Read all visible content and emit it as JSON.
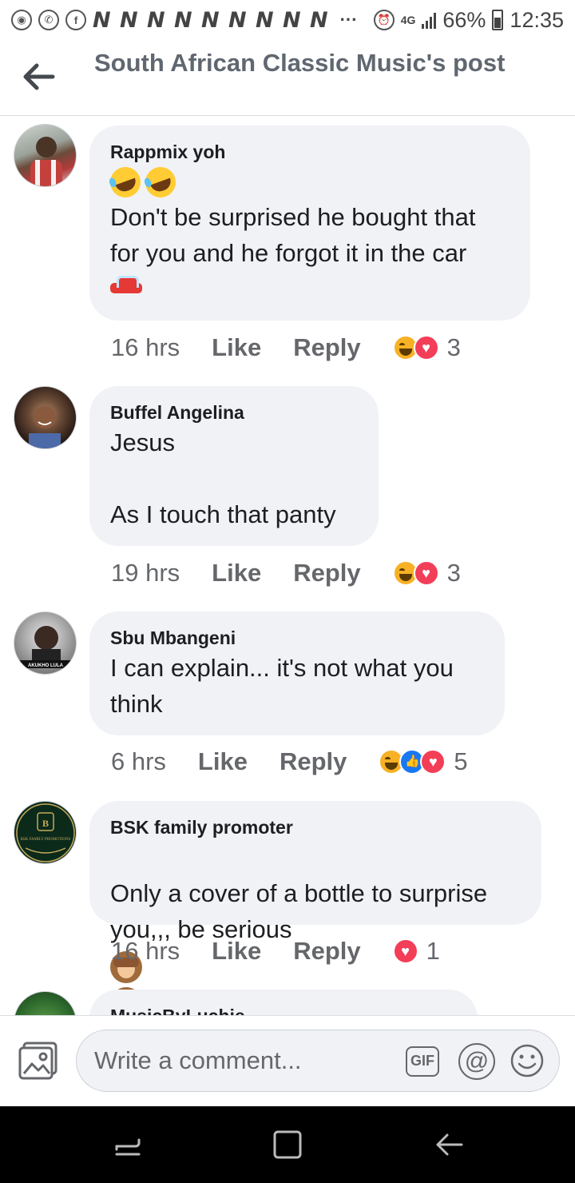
{
  "status_bar": {
    "n_icons": "N N N N N N N N N",
    "dots": "···",
    "network": "4G",
    "battery": "66%",
    "time": "12:35"
  },
  "header": {
    "title": "South African Classic Music's post",
    "back_icon": "arrow-left-icon"
  },
  "comments": [
    {
      "author": "Rappmix yoh",
      "text": "Don't be surprised he bought that for you and he forgot it in the car",
      "time": "16 hrs",
      "like": "Like",
      "reply": "Reply",
      "reaction_count": "3"
    },
    {
      "author": "Buffel Angelina",
      "text": "Jesus\n\nAs I touch that panty",
      "time": "19 hrs",
      "like": "Like",
      "reply": "Reply",
      "reaction_count": "3"
    },
    {
      "author": "Sbu Mbangeni",
      "avatar_label": "AKUKHO LULA",
      "text": "I can explain... it's not what you think",
      "time": "6 hrs",
      "like": "Like",
      "reply": "Reply",
      "reaction_count": "5"
    },
    {
      "author": "BSK family promoter",
      "avatar_label": "BSK FAMILY PROMOTIONS",
      "text": "Only a cover of a bottle to surprise you,,, be serious",
      "time": "16 hrs",
      "like": "Like",
      "reply": "Reply",
      "reaction_count": "1"
    },
    {
      "author": "MusicByLuchie"
    }
  ],
  "composer": {
    "placeholder": "Write a comment...",
    "gif_label": "GIF",
    "at_label": "@"
  },
  "colors": {
    "bubble_bg": "#f0f2f5",
    "haha": "#f7b125",
    "love": "#f33e58",
    "like": "#1877f2"
  }
}
